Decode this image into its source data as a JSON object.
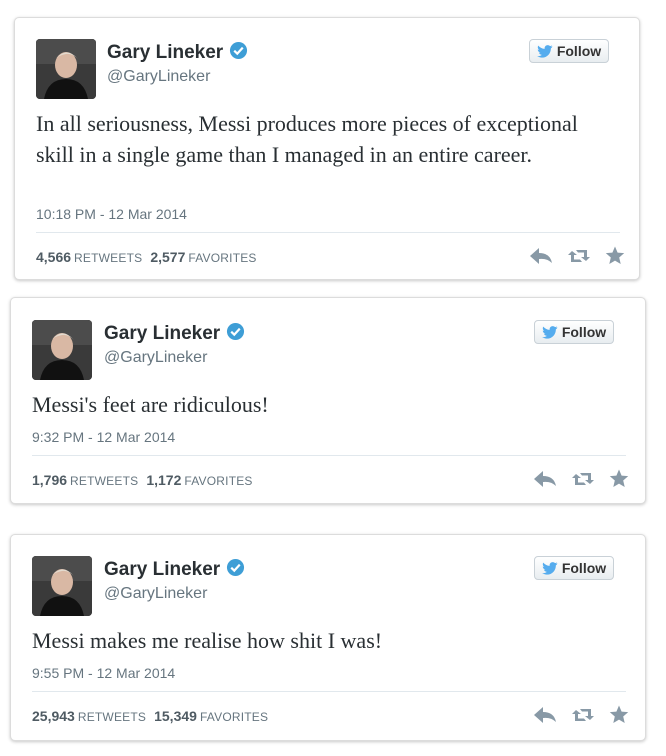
{
  "colors": {
    "follow_bird": "#55acee",
    "verified": "#3e9ed6",
    "text": "#292f33",
    "meta": "#66757f"
  },
  "tweets": [
    {
      "name": "Gary Lineker",
      "handle": "@GaryLineker",
      "follow_label": "Follow",
      "text": "In all seriousness, Messi produces more pieces of exceptional skill in a single game than I managed in an entire career.",
      "timestamp": "10:18 PM - 12 Mar 2014",
      "retweets": "4,566",
      "retweets_label": "RETWEETS",
      "favorites": "2,577",
      "favorites_label": "FAVORITES"
    },
    {
      "name": "Gary Lineker",
      "handle": "@GaryLineker",
      "follow_label": "Follow",
      "text": "Messi's feet are ridiculous!",
      "timestamp": "9:32 PM - 12 Mar 2014",
      "retweets": "1,796",
      "retweets_label": "RETWEETS",
      "favorites": "1,172",
      "favorites_label": "FAVORITES"
    },
    {
      "name": "Gary Lineker",
      "handle": "@GaryLineker",
      "follow_label": "Follow",
      "text": "Messi makes me realise how shit I was!",
      "timestamp": "9:55 PM - 12 Mar 2014",
      "retweets": "25,943",
      "retweets_label": "RETWEETS",
      "favorites": "15,349",
      "favorites_label": "FAVORITES"
    }
  ]
}
